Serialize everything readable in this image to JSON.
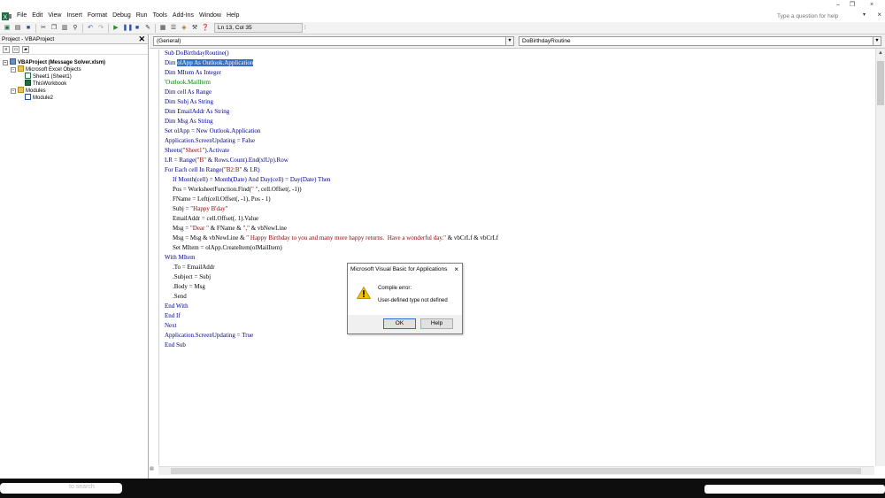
{
  "window": {
    "min": "–",
    "restore": "❐",
    "close": "×"
  },
  "menu": [
    "File",
    "Edit",
    "View",
    "Insert",
    "Format",
    "Debug",
    "Run",
    "Tools",
    "Add-Ins",
    "Window",
    "Help"
  ],
  "help_box": {
    "placeholder": "Type a question for help"
  },
  "toolbar": {
    "position": "Ln 13, Col 35"
  },
  "project": {
    "title": "Project - VBAProject",
    "tree": {
      "root": "VBAProject (Message Solver.xlsm)",
      "folder1": "Microsoft Excel Objects",
      "sheet1": "Sheet1 (Sheet1)",
      "workbook": "ThisWorkbook",
      "folder2": "Modules",
      "module": "Module2"
    }
  },
  "code_window": {
    "object_combo": "(General)",
    "proc_combo": "DoBirthdayRoutine"
  },
  "code": {
    "l1": "Sub DoBirthdayRoutine()",
    "l2a": "Dim ",
    "l2b": "olApp As Outlook.Application",
    "l3": "Dim MItem As Integer",
    "l4": "'Outlook.MailItem",
    "l5": "Dim cell As Range",
    "l6": "Dim Subj As String",
    "l7": "Dim EmailAddr As String",
    "l8": "Dim Msg As String",
    "l9": "Set olApp = New Outlook.Application",
    "l10": "Application.ScreenUpdating = False",
    "l11a": "Sheets(",
    "l11b": "\"Sheet1\"",
    "l11c": ").Activate",
    "l12a": "LR = Range(",
    "l12b": "\"B\"",
    "l12c": " & Rows.Count).End(xlUp).Row",
    "l13a": "For Each cell In Range(",
    "l13b": "\"B2:B\"",
    "l13c": " & LR)",
    "l14": "If Month(cell) = Month(Date) And Day(cell) = Day(Date) Then",
    "l15a": "Pos = WorksheetFunction.Find(",
    "l15b": "\" \"",
    "l15c": ", cell.Offset(, -1))",
    "l16": "FName = Left(cell.Offset(, -1), Pos - 1)",
    "l17a": "Subj = ",
    "l17b": "\"Happy B'day\"",
    "l18": "EmailAddr = cell.Offset(, 1).Value",
    "l19a": "Msg = ",
    "l19b": "\"Dear \"",
    "l19c": " & FName & ",
    "l19d": "\",\"",
    "l19e": " & vbNewLine",
    "l20a": "Msg = Msg & vbNewLine & ",
    "l20b": "\" Happy Birthday to you and many more happy returns.  Have a wonderful day.\"",
    "l20c": " & vbCrLf & vbCrLf",
    "l21": "Set MItem = olApp.CreateItem(olMailItem)",
    "l22": "With MItem",
    "l23": ".To = EmailAddr",
    "l24": ".Subject = Subj",
    "l25": ".Body = Msg",
    "l26": ".Send",
    "l27": "End With",
    "l28": "End If",
    "l29": "Next",
    "l30": "Application.ScreenUpdating = True",
    "l31": "End Sub"
  },
  "dialog": {
    "title": "Microsoft Visual Basic for Applications",
    "close": "×",
    "line1": "Compile error:",
    "line2": "User-defined type not defined",
    "ok": "OK",
    "help": "Help"
  },
  "taskbar": {
    "search": "to search"
  },
  "colors": {
    "keyword": "#00008b",
    "string": "#8b0000",
    "comment": "#008000",
    "selection": "#3070c8"
  }
}
